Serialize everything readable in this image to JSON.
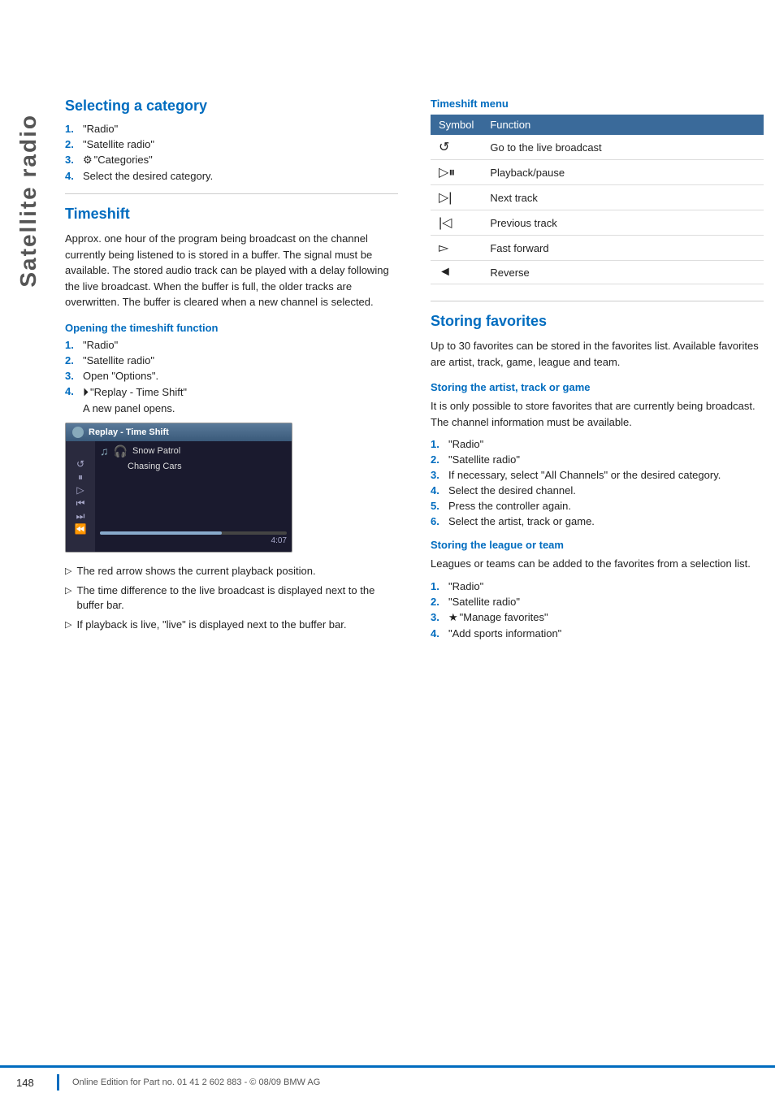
{
  "sidebar": {
    "label": "Satellite radio"
  },
  "selecting_category": {
    "title": "Selecting a category",
    "steps": [
      {
        "num": "1.",
        "text": "\"Radio\""
      },
      {
        "num": "2.",
        "text": "\"Satellite radio\""
      },
      {
        "num": "3.",
        "icon": "categories-icon",
        "text": "\"Categories\""
      },
      {
        "num": "4.",
        "text": "Select the desired category."
      }
    ]
  },
  "timeshift": {
    "title": "Timeshift",
    "body": "Approx. one hour of the program being broadcast on the channel currently being listened to is stored in a buffer. The signal must be available. The stored audio track can be played with a delay following the live broadcast. When the buffer is full, the older tracks are overwritten. The buffer is cleared when a new channel is selected.",
    "opening": {
      "subtitle": "Opening the timeshift function",
      "steps": [
        {
          "num": "1.",
          "text": "\"Radio\""
        },
        {
          "num": "2.",
          "text": "\"Satellite radio\""
        },
        {
          "num": "3.",
          "text": "Open \"Options\"."
        },
        {
          "num": "4.",
          "icon": "replay-icon",
          "text": "\"Replay - Time Shift\"",
          "sub": "A new panel opens."
        }
      ]
    },
    "screenshot": {
      "title": "Replay - Time Shift",
      "track1": "Snow Patrol",
      "track2": "Chasing Cars",
      "time": "4:07"
    },
    "bullets": [
      "The red arrow shows the current playback position.",
      "The time difference to the live broadcast is displayed next to the buffer bar.",
      "If playback is live, \"live\" is displayed next to the buffer bar."
    ]
  },
  "timeshift_menu": {
    "title": "Timeshift menu",
    "col_symbol": "Symbol",
    "col_function": "Function",
    "rows": [
      {
        "symbol": "↺",
        "function": "Go to the live broadcast"
      },
      {
        "symbol": "▷❙❙",
        "function": "Playback/pause"
      },
      {
        "symbol": "▷|",
        "function": "Next track"
      },
      {
        "symbol": "|◁",
        "function": "Previous track"
      },
      {
        "symbol": "▷▷",
        "function": "Fast forward"
      },
      {
        "symbol": "◁◁",
        "function": "Reverse"
      }
    ]
  },
  "storing_favorites": {
    "title": "Storing favorites",
    "body": "Up to 30 favorites can be stored in the favorites list. Available favorites are artist, track, game, league and team.",
    "artist_track_game": {
      "subtitle": "Storing the artist, track or game",
      "body": "It is only possible to store favorites that are currently being broadcast. The channel information must be available.",
      "steps": [
        {
          "num": "1.",
          "text": "\"Radio\""
        },
        {
          "num": "2.",
          "text": "\"Satellite radio\""
        },
        {
          "num": "3.",
          "text": "If necessary, select \"All Channels\" or the desired category."
        },
        {
          "num": "4.",
          "text": "Select the desired channel."
        },
        {
          "num": "5.",
          "text": "Press the controller again."
        },
        {
          "num": "6.",
          "text": "Select the artist, track or game."
        }
      ]
    },
    "league_team": {
      "subtitle": "Storing the league or team",
      "body": "Leagues or teams can be added to the favorites from a selection list.",
      "steps": [
        {
          "num": "1.",
          "text": "\"Radio\""
        },
        {
          "num": "2.",
          "text": "\"Satellite radio\""
        },
        {
          "num": "3.",
          "icon": "manage-favorites-icon",
          "text": "\"Manage favorites\""
        },
        {
          "num": "4.",
          "text": "\"Add sports information\""
        }
      ]
    }
  },
  "footer": {
    "page_num": "148",
    "notice": "Online Edition for Part no. 01 41 2 602 883 - © 08/09 BMW AG"
  }
}
